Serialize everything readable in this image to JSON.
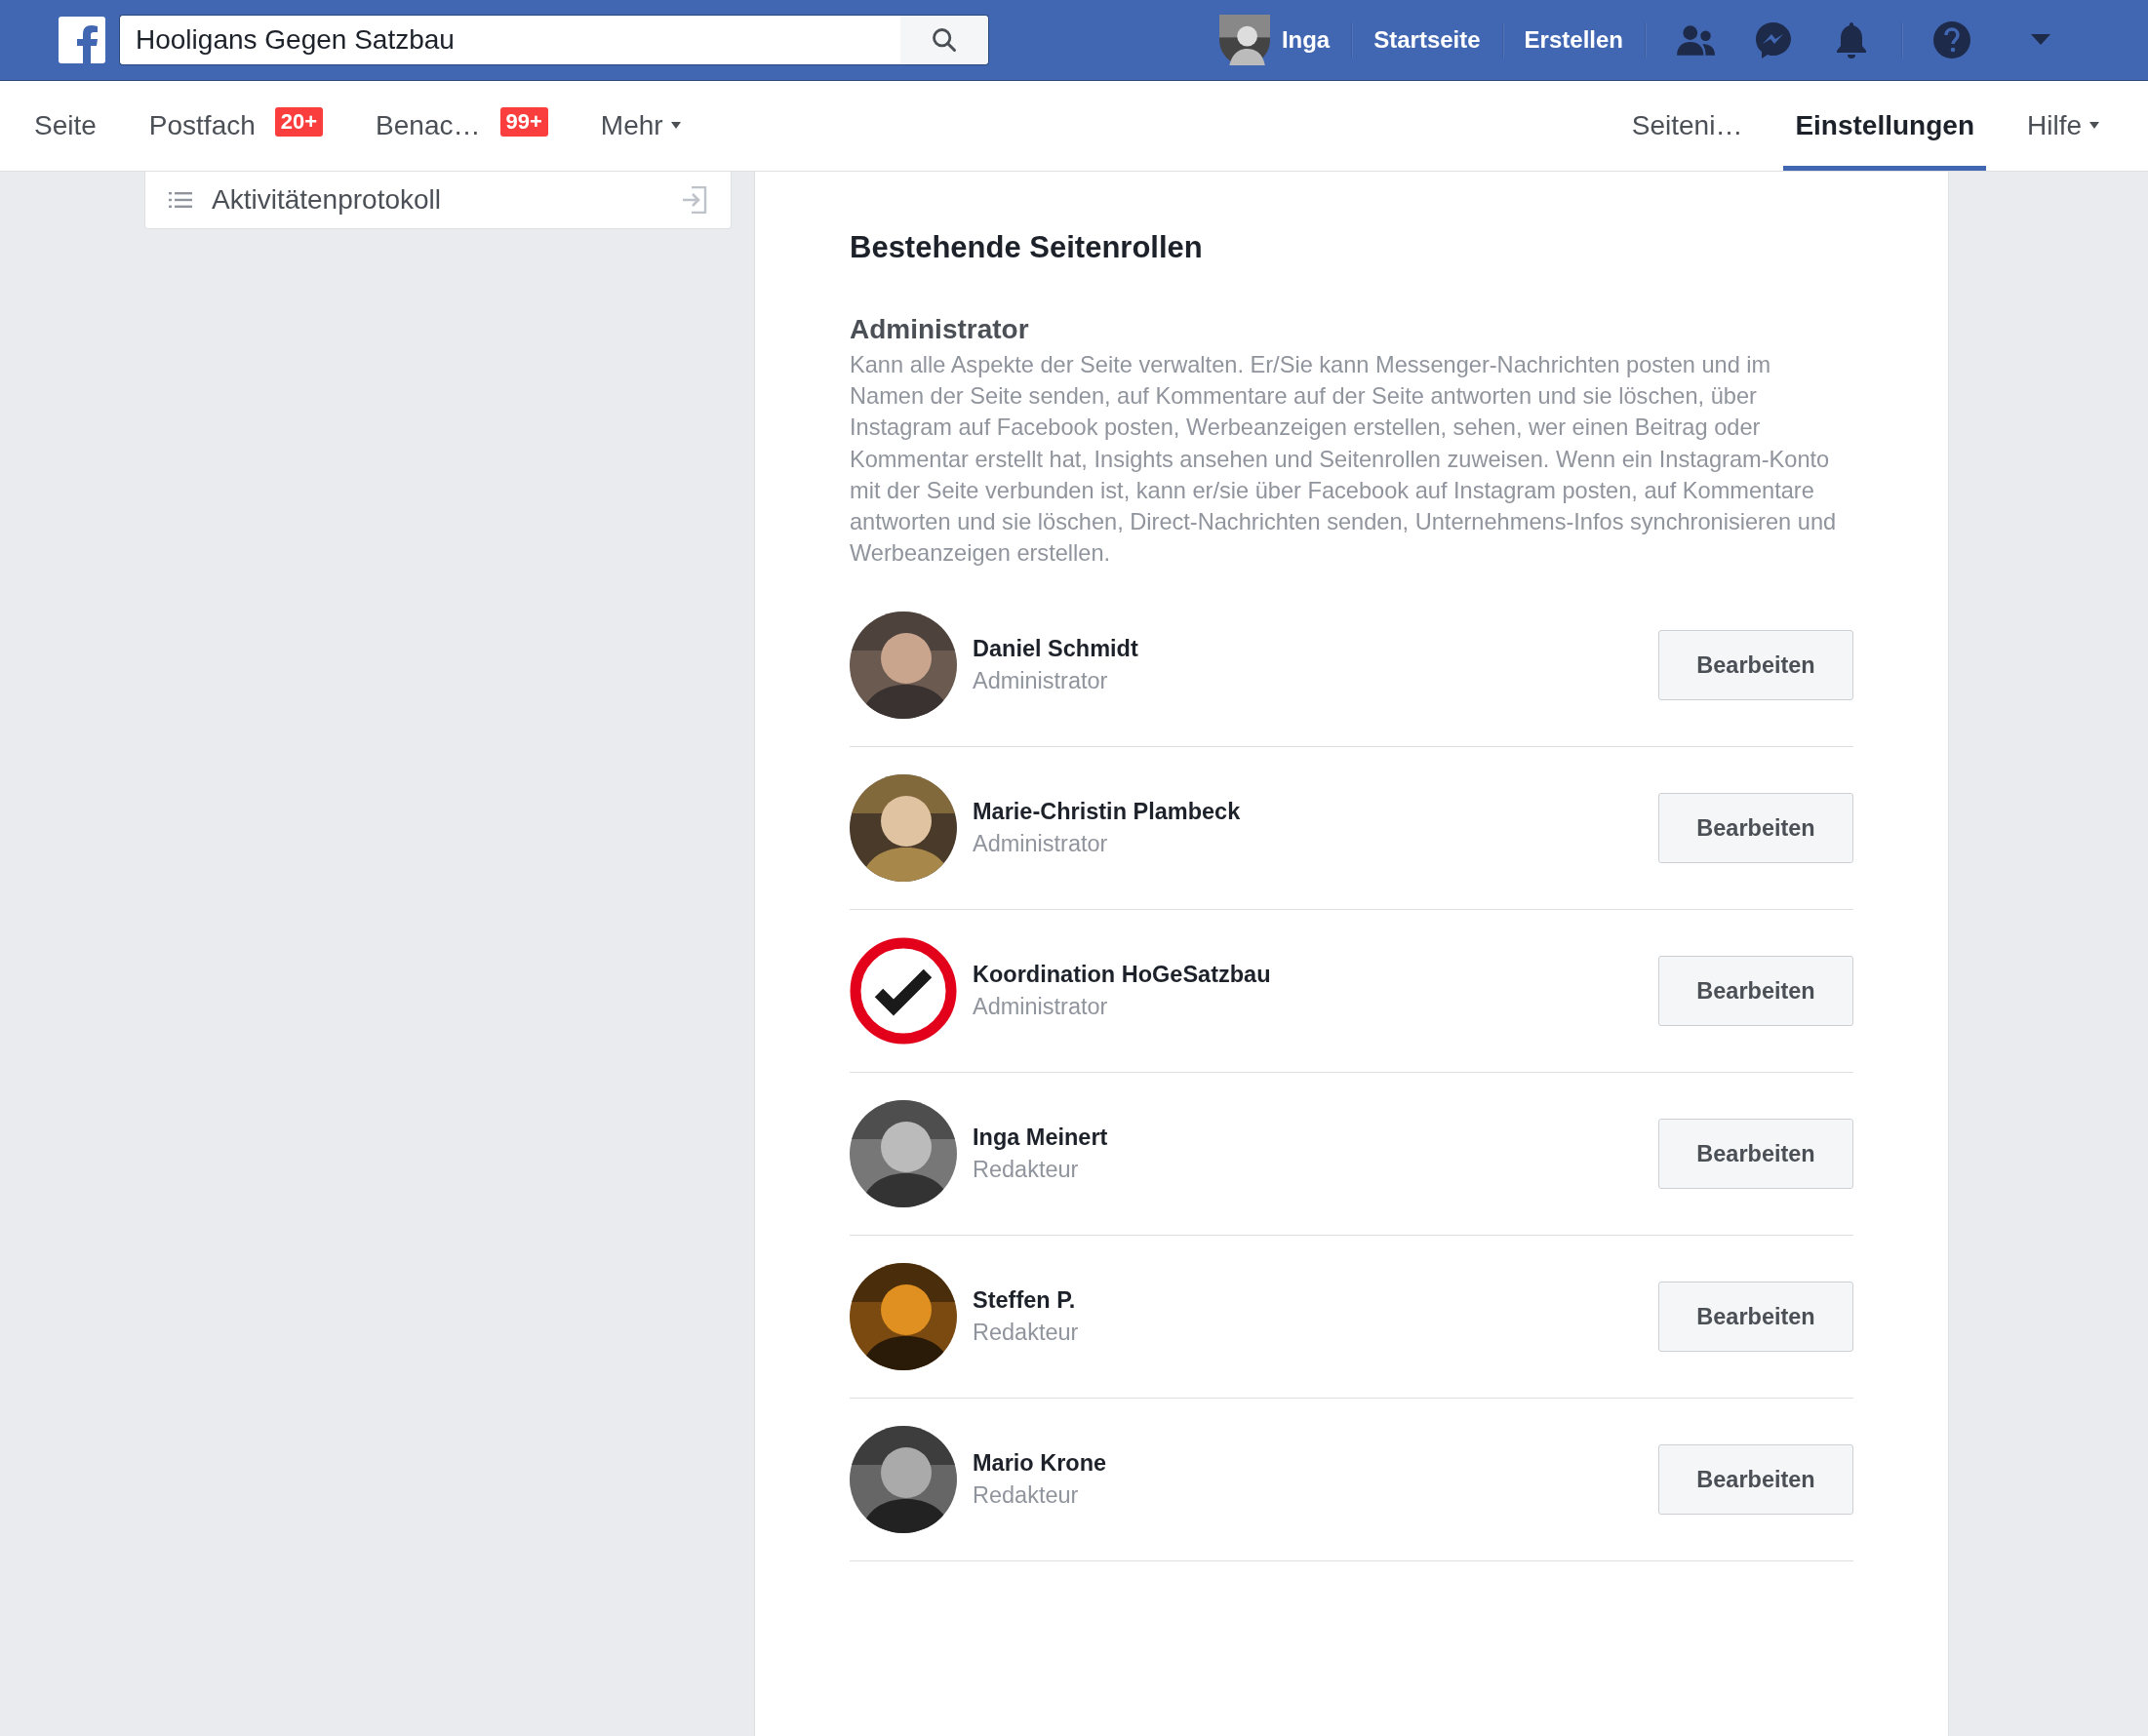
{
  "top_bar": {
    "search": {
      "value": "Hooligans Gegen Satzbau"
    },
    "profile": {
      "name": "Inga"
    },
    "links": [
      "Startseite",
      "Erstellen"
    ]
  },
  "page_tabs": {
    "left": [
      {
        "label": "Seite",
        "selected": false,
        "has_menu": false
      },
      {
        "label": "Postfach",
        "badge": "20+",
        "selected": false,
        "has_menu": false
      },
      {
        "label": "Benac…",
        "badge": "99+",
        "selected": false,
        "has_menu": false
      },
      {
        "label": "Mehr",
        "selected": false,
        "has_menu": true
      }
    ],
    "right": [
      {
        "label": "Seiteni…",
        "selected": false,
        "has_menu": false
      },
      {
        "label": "Einstellungen",
        "selected": true,
        "has_menu": false
      },
      {
        "label": "Hilfe",
        "selected": false,
        "has_menu": true
      }
    ]
  },
  "sidebar": {
    "items": [
      {
        "label": "Aktivitätenprotokoll"
      }
    ]
  },
  "content": {
    "heading": "Bestehende Seitenrollen",
    "role": {
      "title": "Administrator",
      "description": "Kann alle Aspekte der Seite verwalten. Er/Sie kann Messenger-Nachrichten posten und im Namen der Seite senden, auf Kommentare auf der Seite antworten und sie löschen, über Instagram auf Facebook posten, Werbeanzeigen erstellen, sehen, wer einen Beitrag oder Kommentar erstellt hat, Insights ansehen und Seitenrollen zuweisen. Wenn ein Instagram-Konto mit der Seite verbunden ist, kann er/sie über Facebook auf Instagram posten, auf Kommentare antworten und sie löschen, Direct-Nachrichten senden, Unternehmens-Infos synchronisieren und Werbeanzeigen erstellen."
    },
    "members": [
      {
        "name": "Daniel Schmidt",
        "role": "Administrator",
        "kind": "picture",
        "button": "Bearbeiten"
      },
      {
        "name": "Marie-Christin Plambeck",
        "role": "Administrator",
        "kind": "picture",
        "button": "Bearbeiten"
      },
      {
        "name": "Koordination HoGeSatzbau",
        "role": "Administrator",
        "kind": "logo",
        "button": "Bearbeiten"
      },
      {
        "name": "Inga Meinert",
        "role": "Redakteur",
        "kind": "picture",
        "button": "Bearbeiten"
      },
      {
        "name": "Steffen P.",
        "role": "Redakteur",
        "kind": "picture",
        "button": "Bearbeiten"
      },
      {
        "name": "Mario Krone",
        "role": "Redakteur",
        "kind": "picture",
        "button": "Bearbeiten"
      }
    ]
  }
}
